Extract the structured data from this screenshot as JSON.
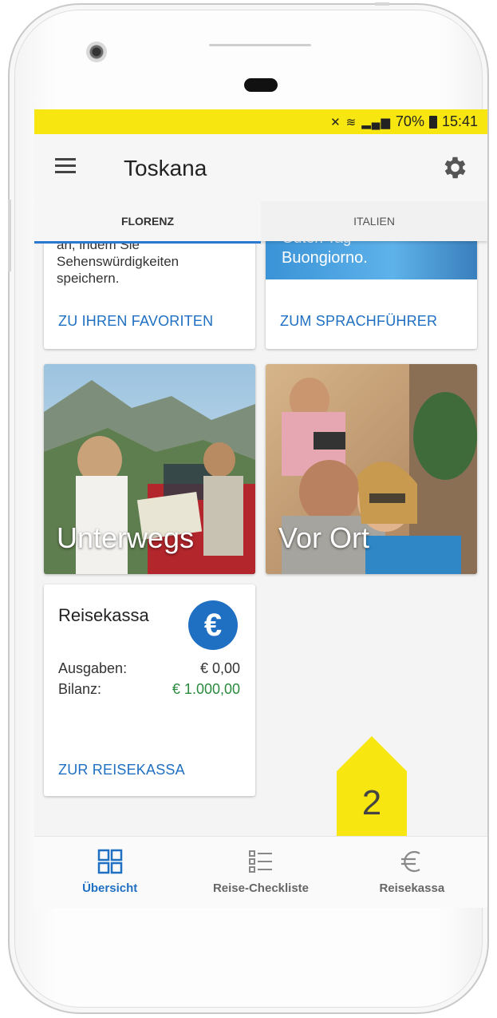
{
  "status_bar": {
    "signal_text": "70%",
    "time": "15:41",
    "icons": [
      "mute-icon",
      "wifi-icon",
      "signal-icon",
      "battery-icon"
    ]
  },
  "app_bar": {
    "title": "Toskana",
    "menu_icon": "hamburger-menu-icon",
    "settings_icon": "gear-icon"
  },
  "tabs": [
    {
      "label": "FLORENZ",
      "active": true
    },
    {
      "label": "ITALIEN",
      "active": false
    }
  ],
  "favorites_card": {
    "text_lines": [
      "an, indem Sie",
      "Sehenswürdigkeiten",
      "speichern."
    ],
    "link": "ZU IHREN FAVORITEN"
  },
  "phrasebook_card": {
    "banner_line1": "Guten Tag",
    "banner_line2": "Buongiorno.",
    "link": "ZUM SPRACHFÜHRER"
  },
  "tiles": [
    {
      "label": "Unterwegs"
    },
    {
      "label": "Vor Ort"
    }
  ],
  "reisekassa_card": {
    "title": "Reisekassa",
    "badge": "€",
    "ausgaben_label": "Ausgaben:",
    "ausgaben_value": "€ 0,00",
    "bilanz_label": "Bilanz:",
    "bilanz_value": "€ 1.000,00",
    "link": "ZUR REISEKASSA"
  },
  "callout": {
    "label": "2",
    "color": "#f7e60f"
  },
  "bottom_nav": [
    {
      "label": "Übersicht",
      "icon": "grid-icon",
      "active": true
    },
    {
      "label": "Reise-Checkliste",
      "icon": "checklist-icon",
      "active": false
    },
    {
      "label": "Reisekassa",
      "icon": "euro-icon",
      "active": false
    }
  ],
  "colors": {
    "accent": "#1f6fc2",
    "status_bar": "#f7e60f",
    "positive": "#2a8a3e"
  }
}
